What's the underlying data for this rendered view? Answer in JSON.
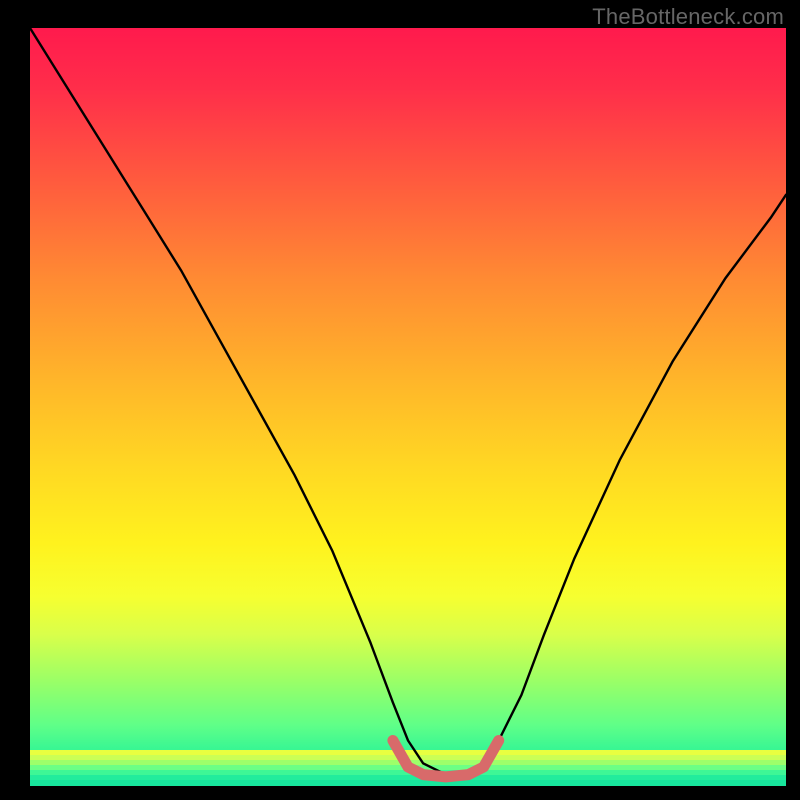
{
  "watermark": "TheBottleneck.com",
  "chart_data": {
    "type": "line",
    "title": "",
    "xlabel": "",
    "ylabel": "",
    "xlim": [
      0,
      100
    ],
    "ylim": [
      0,
      100
    ],
    "series": [
      {
        "name": "bottleneck-curve",
        "x": [
          0,
          5,
          10,
          15,
          20,
          25,
          30,
          35,
          40,
          45,
          48,
          50,
          52,
          55,
          58,
          60,
          62,
          65,
          68,
          72,
          78,
          85,
          92,
          98,
          100
        ],
        "values": [
          100,
          92,
          84,
          76,
          68,
          59,
          50,
          41,
          31,
          19,
          11,
          6,
          3,
          1.5,
          1.5,
          3,
          6,
          12,
          20,
          30,
          43,
          56,
          67,
          75,
          78
        ]
      },
      {
        "name": "optimal-band",
        "x": [
          48,
          50,
          52,
          55,
          58,
          60,
          62
        ],
        "values": [
          6,
          2.5,
          1.5,
          1.2,
          1.5,
          2.5,
          6
        ]
      }
    ],
    "gradient_stops": [
      {
        "pos": 0,
        "color": "#ff1a4d"
      },
      {
        "pos": 20,
        "color": "#ff5a3e"
      },
      {
        "pos": 46,
        "color": "#ffb42a"
      },
      {
        "pos": 68,
        "color": "#fff21e"
      },
      {
        "pos": 86,
        "color": "#9cff66"
      },
      {
        "pos": 100,
        "color": "#18e59c"
      }
    ],
    "curve_stroke": "#000000",
    "band_stroke": "#d86a6a"
  }
}
